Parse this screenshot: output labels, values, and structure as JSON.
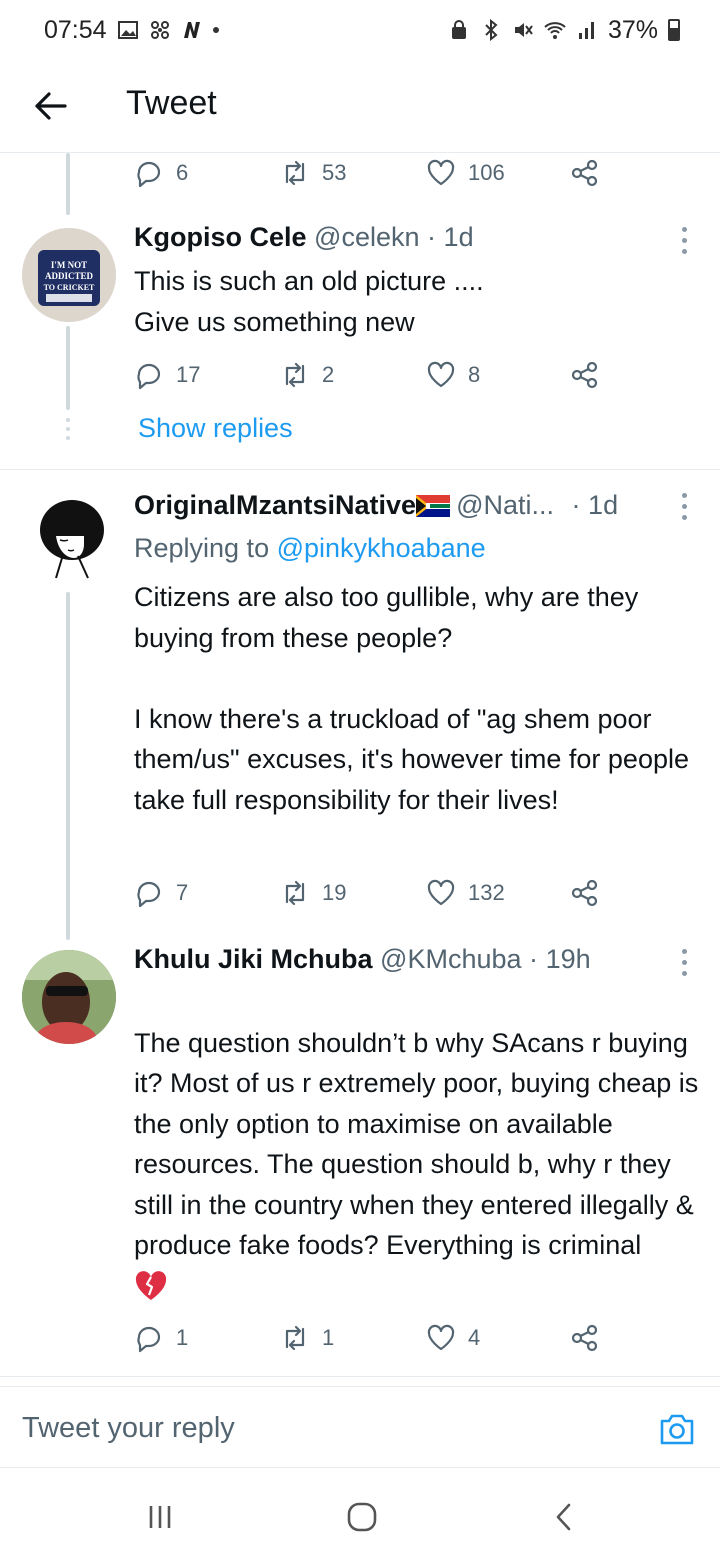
{
  "status_bar": {
    "time": "07:54",
    "battery": "37%"
  },
  "header": {
    "title": "Tweet"
  },
  "top_actions": {
    "replies": "6",
    "retweets": "53",
    "likes": "106"
  },
  "tweets": [
    {
      "name": "Kgopiso Cele",
      "handle": "@celekn",
      "separator": "·",
      "time": "1d",
      "text": "This is such an old picture ....\nGive us something new",
      "replies": "17",
      "retweets": "2",
      "likes": "8",
      "avatar_text": [
        "I'M NOT",
        "ADDICTED",
        "TO CRICKET"
      ]
    },
    {
      "name": "OriginalMzantsiNative",
      "handle": "@Nati...",
      "separator": "·",
      "time": "1d",
      "replying_prefix": "Replying to",
      "replying_to": "@pinkykhoabane",
      "text": "Citizens are also too gullible, why are they buying from these people?\n\nI know there's a truckload of \"ag shem poor them/us\" excuses, it's however time for people take full responsibility for their  lives!",
      "replies": "7",
      "retweets": "19",
      "likes": "132"
    },
    {
      "name": "Khulu Jiki Mchuba",
      "handle": "@KMchuba",
      "separator": "·",
      "time": "19h",
      "text": "The question shouldn’t b why SAcans r buying it? Most of us r extremely poor, buying cheap is the only option to maximise on available resources. The question should b, why r they still in the country when they entered illegally & produce fake foods? Everything is criminal",
      "replies": "1",
      "retweets": "1",
      "likes": "4"
    }
  ],
  "show_replies": "Show replies",
  "composer": {
    "placeholder": "Tweet your reply"
  },
  "colors": {
    "link": "#1d9bf0",
    "muted": "#536471",
    "text": "#0f1419",
    "divider": "#e6ecf0"
  }
}
